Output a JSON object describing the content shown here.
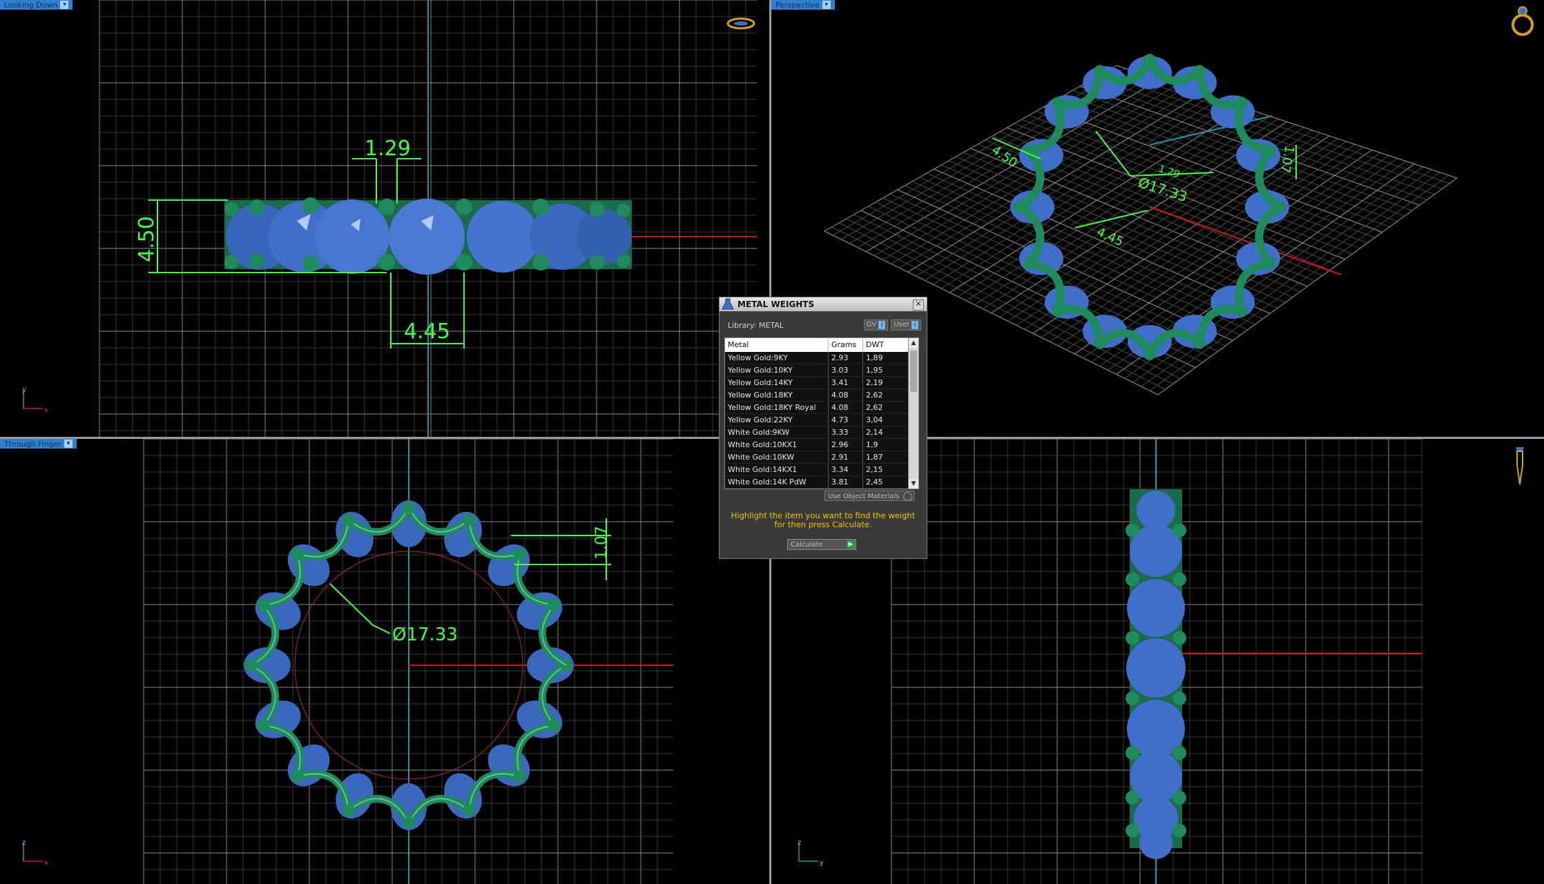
{
  "viewports": {
    "top_left": {
      "label": "Looking Down"
    },
    "top_right": {
      "label": "Perspective"
    },
    "bottom_left": {
      "label": "Through Finger"
    },
    "bottom_right": {
      "label": ""
    }
  },
  "dimensions": {
    "top_left": {
      "gap": "1.29",
      "height": "4.50",
      "stone": "4.45"
    },
    "top_right": {
      "width": "4.50",
      "diameter": "Ø17.33",
      "height": "1.07",
      "gap": "1.29",
      "stone": "4.45"
    },
    "bottom_left": {
      "diameter": "Ø17.33",
      "height": "1.07"
    }
  },
  "axes": {
    "top_left": {
      "vertical": "y",
      "horizontal": "x"
    },
    "bottom_left": {
      "vertical": "z",
      "horizontal": "x"
    },
    "bottom_right": {
      "vertical": "z",
      "horizontal": "y"
    }
  },
  "colors": {
    "metal": "#1f8a5c",
    "stone": "#3f6fc8",
    "dimension": "#44ff44",
    "axis_x": "#d01818",
    "axis_y": "#1a9aa8"
  },
  "dialog": {
    "title": "METAL WEIGHTS",
    "library_label": "Library:",
    "library_value": "METAL",
    "gv_button": "GV",
    "user_button": "User",
    "columns": [
      "Metal",
      "Grams",
      "DWT"
    ],
    "rows": [
      [
        "Yellow Gold:9KY",
        "2.93",
        "1,89"
      ],
      [
        "Yellow Gold:10KY",
        "3.03",
        "1,95"
      ],
      [
        "Yellow Gold:14KY",
        "3.41",
        "2,19"
      ],
      [
        "Yellow Gold:18KY",
        "4.08",
        "2,62"
      ],
      [
        "Yellow Gold:18KY Royal",
        "4.08",
        "2,62"
      ],
      [
        "Yellow Gold:22KY",
        "4.73",
        "3,04"
      ],
      [
        "White Gold:9KW",
        "3.33",
        "2,14"
      ],
      [
        "White Gold:10KX1",
        "2.96",
        "1,9"
      ],
      [
        "White Gold:10KW",
        "2.91",
        "1,87"
      ],
      [
        "White Gold:14KX1",
        "3.34",
        "2,15"
      ],
      [
        "White Gold:14K PdW",
        "3.81",
        "2,45"
      ]
    ],
    "use_object_materials": "Use Object Materials",
    "hint": "Highlight the item you want to find the weight for then press Calculate.",
    "calculate_button": "Calculate"
  }
}
